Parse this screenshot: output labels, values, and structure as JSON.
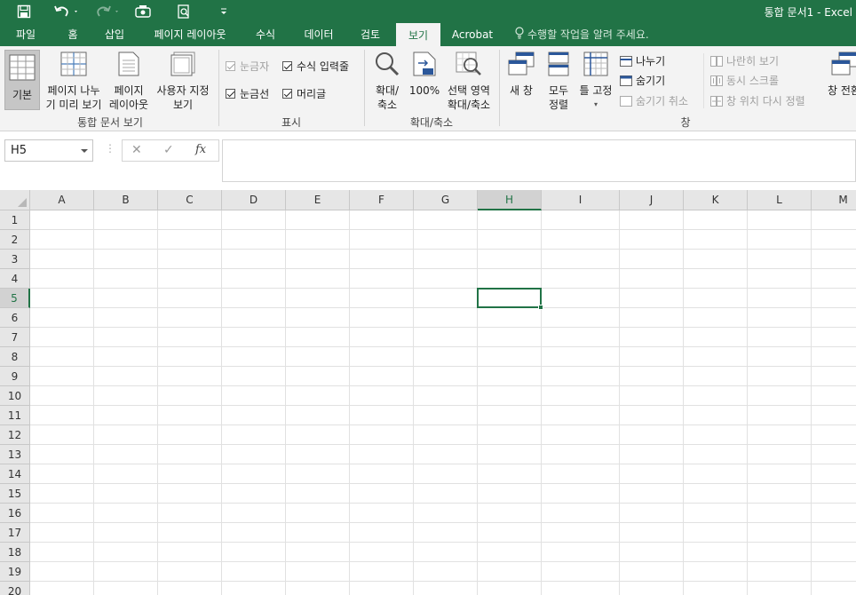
{
  "title_bar": {
    "document_title": "통합 문서1 - Excel",
    "quick_access": [
      "save-icon",
      "undo-icon",
      "redo-icon",
      "touch-mode-icon",
      "print-preview-icon",
      "customize-qat-icon"
    ]
  },
  "tabs": [
    {
      "label": "파일"
    },
    {
      "label": "홈"
    },
    {
      "label": "삽입"
    },
    {
      "label": "페이지 레이아웃"
    },
    {
      "label": "수식"
    },
    {
      "label": "데이터"
    },
    {
      "label": "검토"
    },
    {
      "label": "보기",
      "active": true
    },
    {
      "label": "Acrobat"
    }
  ],
  "tell_me": "수행할 작업을 알려 주세요.",
  "ribbon": {
    "workbook_views": {
      "group_label": "통합 문서 보기",
      "normal": "기본",
      "page_break_1": "페이지 나누",
      "page_break_2": "기 미리 보기",
      "page_layout_1": "페이지",
      "page_layout_2": "레이아웃",
      "custom_views_1": "사용자 지정",
      "custom_views_2": "보기"
    },
    "show": {
      "group_label": "표시",
      "ruler": "눈금자",
      "formula_bar": "수식 입력줄",
      "gridlines": "눈금선",
      "headings": "머리글"
    },
    "zoom": {
      "group_label": "확대/축소",
      "zoom_1": "확대/",
      "zoom_2": "축소",
      "zoom_100": "100%",
      "zoom_selection_1": "선택 영역",
      "zoom_selection_2": "확대/축소"
    },
    "window": {
      "group_label": "창",
      "new_window": "새 창",
      "arrange_all_1": "모두",
      "arrange_all_2": "정렬",
      "freeze_panes": "틀 고정",
      "split": "나누기",
      "hide": "숨기기",
      "unhide": "숨기기 취소",
      "view_side_by_side": "나란히 보기",
      "sync_scroll": "동시 스크롤",
      "reset_position": "창 위치 다시 정렬",
      "switch_windows": "창 전환"
    }
  },
  "formula_bar": {
    "name_box": "H5",
    "cancel_icon": "✕",
    "enter_icon": "✓",
    "fx_label": "fx",
    "formula": ""
  },
  "grid": {
    "columns": [
      "A",
      "B",
      "C",
      "D",
      "E",
      "F",
      "G",
      "H",
      "I",
      "J",
      "K",
      "L",
      "M"
    ],
    "rows": [
      "1",
      "2",
      "3",
      "4",
      "5",
      "6",
      "7",
      "8",
      "9",
      "10",
      "11",
      "12",
      "13",
      "14",
      "15",
      "16",
      "17",
      "18",
      "19",
      "20"
    ],
    "active_cell": "H5",
    "colors": {
      "accent": "#217346",
      "header_bg": "#e6e6e6",
      "gridline": "#e1e1e1"
    }
  }
}
